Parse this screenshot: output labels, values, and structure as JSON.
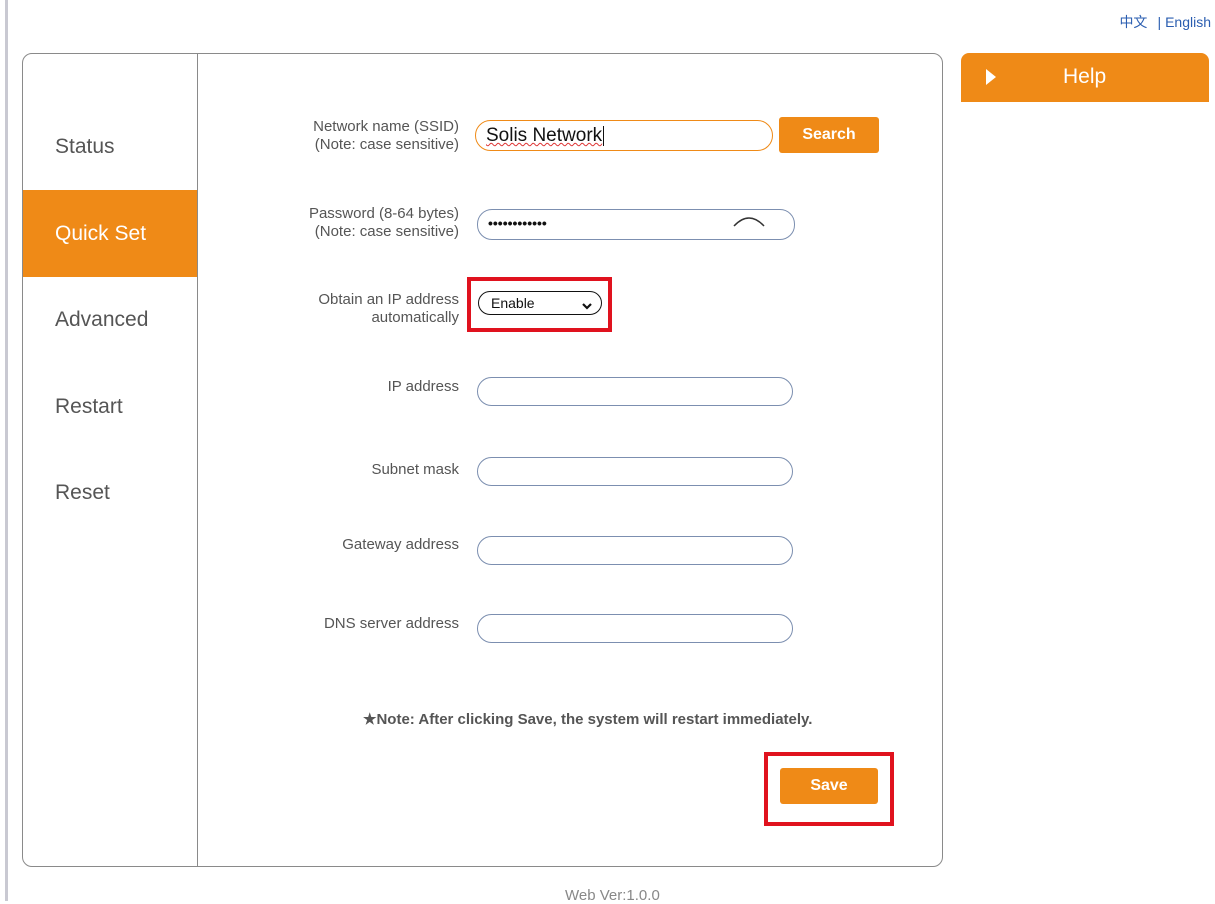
{
  "language": {
    "chinese": "中文",
    "separator": "|",
    "english": "English"
  },
  "sidebar": {
    "items": [
      {
        "label": "Status"
      },
      {
        "label": "Quick Set"
      },
      {
        "label": "Advanced"
      },
      {
        "label": "Restart"
      },
      {
        "label": "Reset"
      }
    ],
    "active": "Quick Set"
  },
  "form": {
    "ssid": {
      "label_line1": "Network name (SSID)",
      "label_line2": "(Note: case sensitive)",
      "value": "Solis Network"
    },
    "search_button": "Search",
    "password": {
      "label_line1": "Password (8-64 bytes)",
      "label_line2": "(Note: case sensitive)",
      "value": "••••••••••••"
    },
    "dhcp": {
      "label_line1": "Obtain an IP address",
      "label_line2": "automatically",
      "selected": "Enable"
    },
    "ip_address": {
      "label": "IP address",
      "value": ""
    },
    "subnet_mask": {
      "label": "Subnet mask",
      "value": ""
    },
    "gateway": {
      "label": "Gateway address",
      "value": ""
    },
    "dns": {
      "label": "DNS server address",
      "value": ""
    },
    "note": "★Note: After clicking Save, the system will restart immediately.",
    "save_button": "Save"
  },
  "help": {
    "label": "Help"
  },
  "footer": {
    "version": "Web Ver:1.0.0"
  },
  "colors": {
    "accent": "#ef8a17",
    "highlight": "#e0121e",
    "link": "#2a5db0"
  }
}
